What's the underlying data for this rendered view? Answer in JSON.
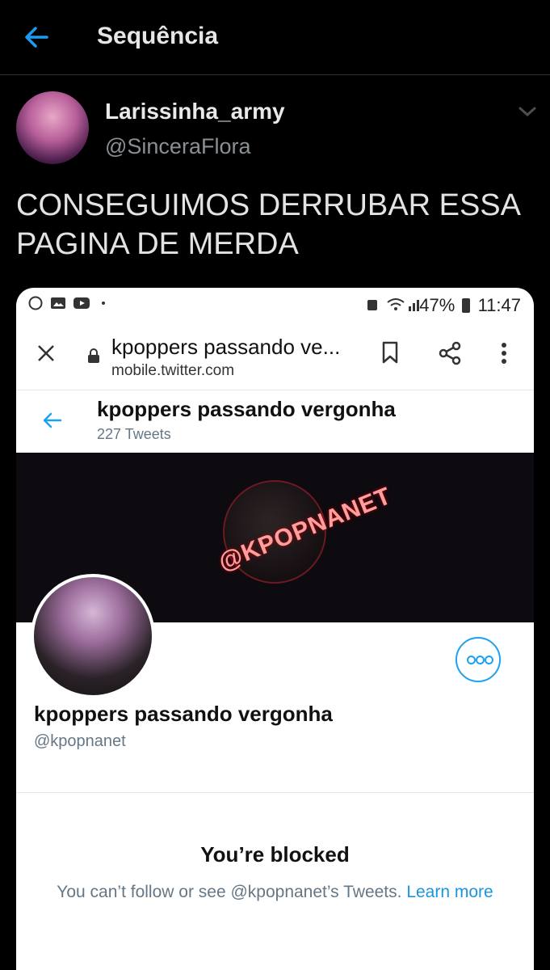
{
  "header": {
    "title": "Sequência"
  },
  "tweet": {
    "author_name": "Larissinha_army",
    "author_handle": "@SinceraFlora",
    "text": "CONSEGUIMOS DERRUBAR ESSA PAGINA DE MERDA"
  },
  "embedded": {
    "status_bar": {
      "battery": "47%",
      "time": "11:47"
    },
    "browser": {
      "page_title": "kpoppers passando ve...",
      "url": "mobile.twitter.com"
    },
    "profile_header": {
      "name": "kpoppers passando vergonha",
      "tweet_count": "227 Tweets"
    },
    "banner_text": "@KPOPNANET",
    "profile": {
      "name": "kpoppers passando vergonha",
      "handle": "@kpopnanet"
    },
    "blocked": {
      "title": "You’re blocked",
      "message": "You can’t follow or see @kpopnanet’s Tweets.",
      "link": "Learn more"
    }
  },
  "colors": {
    "accent": "#1da1f2",
    "link": "#1b95e0",
    "back_arrow": "#1d9bf0"
  }
}
